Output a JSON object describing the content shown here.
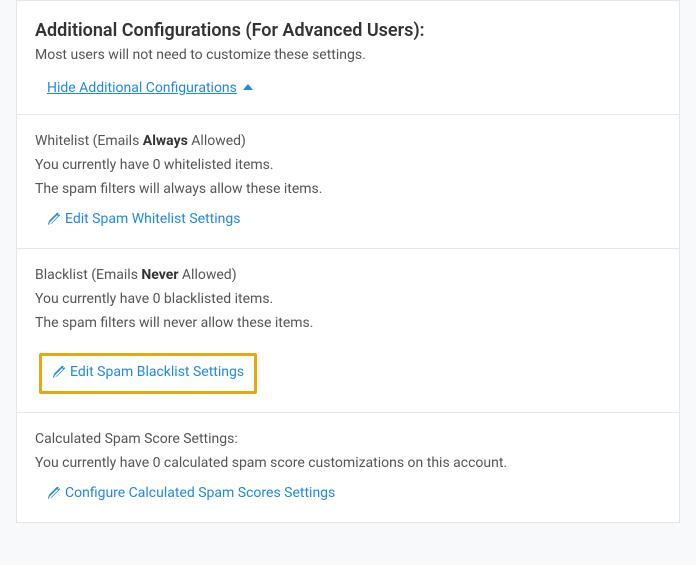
{
  "header": {
    "title": "Additional Configurations (For Advanced Users):",
    "subtitle": "Most users will not need to customize these settings.",
    "toggle_label": "Hide Additional Configurations "
  },
  "whitelist": {
    "heading_pre": "Whitelist (Emails ",
    "heading_bold": "Always",
    "heading_post": " Allowed)",
    "count_line": "You currently have 0 whitelisted items.",
    "desc_line": "The spam filters will always allow these items.",
    "action_label": "Edit Spam Whitelist Settings"
  },
  "blacklist": {
    "heading_pre": "Blacklist (Emails ",
    "heading_bold": "Never",
    "heading_post": " Allowed)",
    "count_line": "You currently have 0 blacklisted items.",
    "desc_line": "The spam filters will never allow these items.",
    "action_label": "Edit Spam Blacklist Settings"
  },
  "score": {
    "heading": "Calculated Spam Score Settings:",
    "count_line": "You currently have 0 calculated spam score customizations on this account.",
    "action_label": "Configure Calculated Spam Scores Settings"
  }
}
